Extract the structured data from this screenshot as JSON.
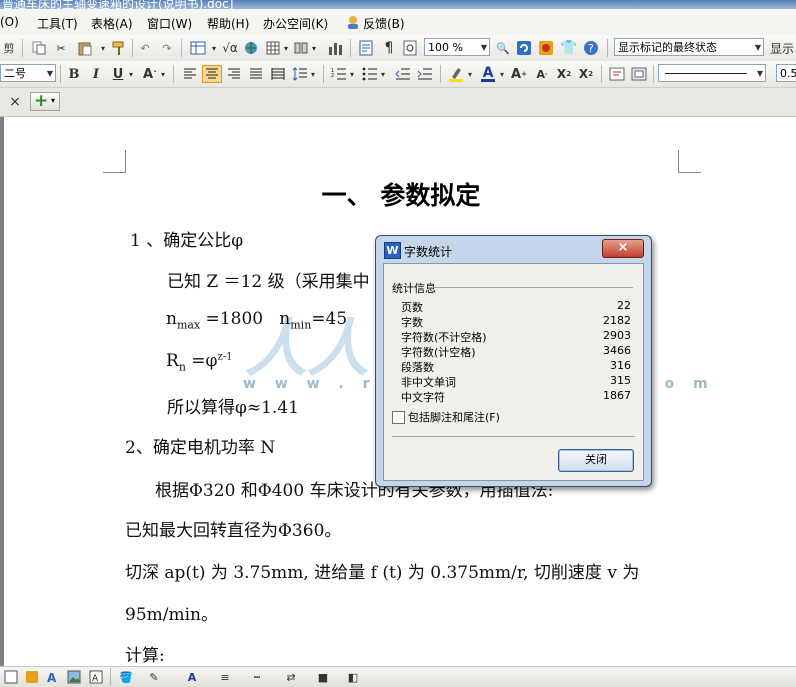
{
  "window": {
    "title": "普通车床的主轴变速箱的设计(说明书).doc]"
  },
  "menu": [
    "(O)",
    "工具(T)",
    "表格(A)",
    "窗口(W)",
    "帮助(H)",
    "办公空间(K)",
    "反馈(B)"
  ],
  "toolbar1": {
    "zoom": "100 %",
    "track_changes": "显示标记的最终状态",
    "show_label": "显示"
  },
  "toolbar2": {
    "font_size": "二号",
    "bold": "B",
    "italic": "I",
    "underline": "U",
    "line_width": "0.5"
  },
  "tabs": {
    "close": "×",
    "new": "+"
  },
  "document": {
    "heading": "一、 参数拟定",
    "lines": [
      "1 、确定公比φ",
      "已知 Z ＝12 级（采用集中",
      "Rn =φz-1",
      "所以算得φ≈1.41",
      "2、确定电机功率 N",
      "根据Φ320 和Φ400 车床设计的有关参数，用插值法:",
      "已知最大回转直径为Φ360。",
      "95m/min。",
      "计算:"
    ],
    "nmax": "1800",
    "nmin": "45",
    "cut_line": "切深 ap(t) 为 3.75mm, 进给量 f (t) 为 0.375mm/r, 切削速度 v 为"
  },
  "watermark": {
    "text": "人人文库",
    "url": "w w w . r e n r e n d o c . c o m"
  },
  "dialog": {
    "title": "字数统计",
    "section": "统计信息",
    "rows": [
      {
        "label": "页数",
        "value": "22"
      },
      {
        "label": "字数",
        "value": "2182"
      },
      {
        "label": "字符数(不计空格)",
        "value": "2903"
      },
      {
        "label": "字符数(计空格)",
        "value": "3466"
      },
      {
        "label": "段落数",
        "value": "316"
      },
      {
        "label": "非中文单词",
        "value": "315"
      },
      {
        "label": "中文字符",
        "value": "1867"
      }
    ],
    "checkbox_label": "包括脚注和尾注(F)",
    "close_button": "关闭",
    "close_x": "×"
  }
}
